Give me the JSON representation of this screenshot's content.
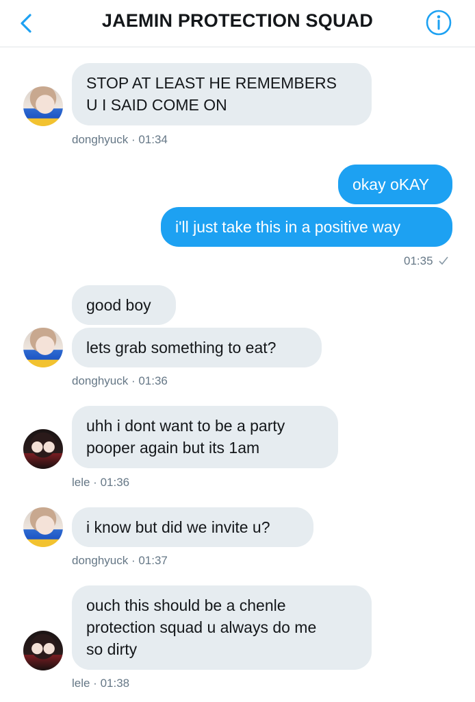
{
  "header": {
    "title": "JAEMIN PROTECTION SQUAD",
    "back_icon": "chevron-left-icon",
    "info_icon": "info-icon",
    "accent": "#1da1f2"
  },
  "messages": [
    {
      "text": "STOP AT LEAST HE REMEMBERS\nU I SAID COME ON",
      "sender": "donghyuck",
      "direction": "incoming"
    },
    {
      "meta": "donghyuck · 01:34"
    },
    {
      "text": "okay oKAY",
      "direction": "outgoing"
    },
    {
      "text": "i'll just take this in a positive way",
      "direction": "outgoing"
    },
    {
      "meta": "01:35",
      "status_icon": "checkmark-icon"
    },
    {
      "text": "good boy",
      "sender": "donghyuck",
      "direction": "incoming"
    },
    {
      "text": "lets grab something to eat?",
      "sender": "donghyuck",
      "direction": "incoming"
    },
    {
      "meta": "donghyuck · 01:36"
    },
    {
      "text": "uhh i dont want to be a party\npooper again but its 1am",
      "sender": "lele",
      "direction": "incoming"
    },
    {
      "meta": "lele · 01:36"
    },
    {
      "text": "i know but did we invite u?",
      "sender": "donghyuck",
      "direction": "incoming"
    },
    {
      "meta": "donghyuck · 01:37"
    },
    {
      "text": "ouch this should be a chenle\nprotection squad u always do me\nso dirty",
      "sender": "lele",
      "direction": "incoming"
    },
    {
      "meta": "lele · 01:38"
    }
  ],
  "colors": {
    "incoming_bubble": "#e6ecf0",
    "outgoing_bubble": "#1da1f2",
    "meta_text": "#657786"
  }
}
